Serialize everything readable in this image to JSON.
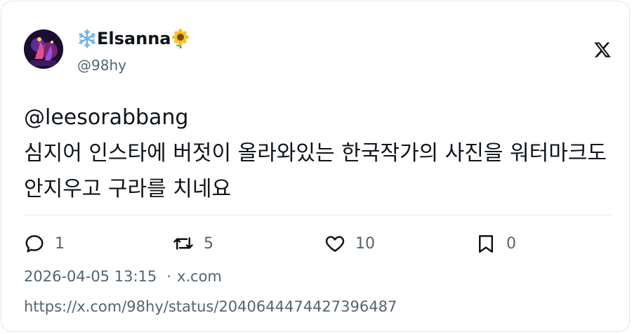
{
  "tweet": {
    "author": {
      "display_name": "Elsanna",
      "handle": "@98hy",
      "prefix_icon": "snowflake-emoji",
      "suffix_icon": "sunflower-emoji"
    },
    "brand_icon": "x-logo-icon",
    "text": "@leesorabbang\n심지어 인스타에 버젓이 올라와있는 한국작가의 사진을 워터마크도 안지우고 구라를 치네요",
    "actions": {
      "reply_count": "1",
      "retweet_count": "5",
      "like_count": "10",
      "bookmark_count": "0"
    },
    "timestamp": "2026-04-05 13:15",
    "separator": "·",
    "source": "x.com",
    "url": "https://x.com/98hy/status/2040644474427396487"
  },
  "colors": {
    "text_primary": "#0f1419",
    "text_secondary": "#536471",
    "border": "#e2e7ea"
  }
}
